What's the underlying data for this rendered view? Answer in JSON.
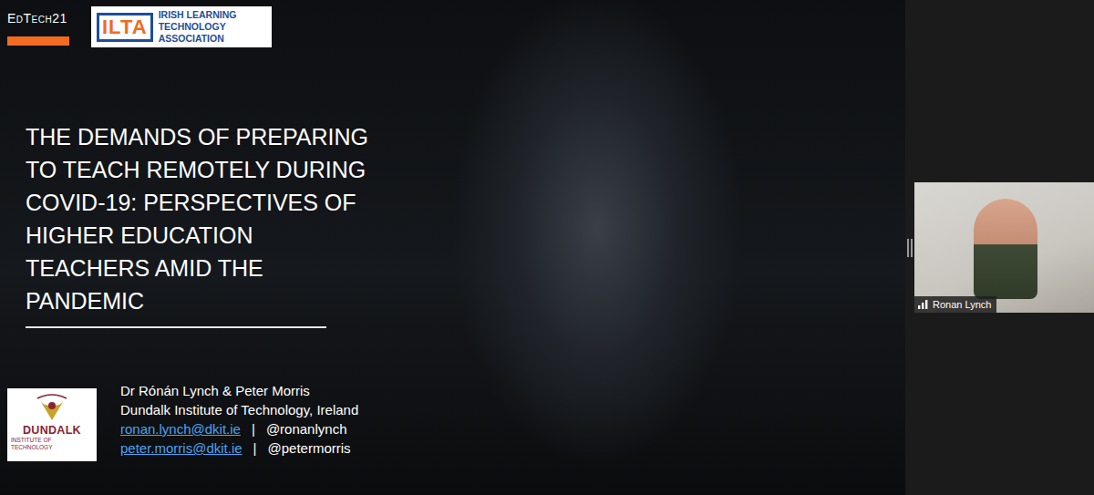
{
  "slide": {
    "event": "EdTech21",
    "partner_logo": {
      "mark": "ILTA",
      "name": "IRISH LEARNING TECHNOLOGY ASSOCIATION"
    },
    "title_lines": [
      "THE DEMANDS OF PREPARING",
      "TO TEACH REMOTELY DURING",
      "COVID-19: PERSPECTIVES OF",
      "HIGHER EDUCATION",
      "TEACHERS AMID THE",
      "PANDEMIC"
    ],
    "institution_logo": {
      "name": "DUNDALK",
      "subtitle": "INSTITUTE OF TECHNOLOGY"
    },
    "authors": "Dr Rónán Lynch & Peter Morris",
    "affiliation": "Dundalk Institute of Technology, Ireland",
    "contacts": [
      {
        "email": "ronan.lynch@dkit.ie",
        "separator": "|",
        "handle": "@ronanlynch"
      },
      {
        "email": "peter.morris@dkit.ie",
        "separator": "|",
        "handle": "@petermorris"
      }
    ]
  },
  "participants": [
    {
      "name": "Ronan Lynch"
    }
  ]
}
